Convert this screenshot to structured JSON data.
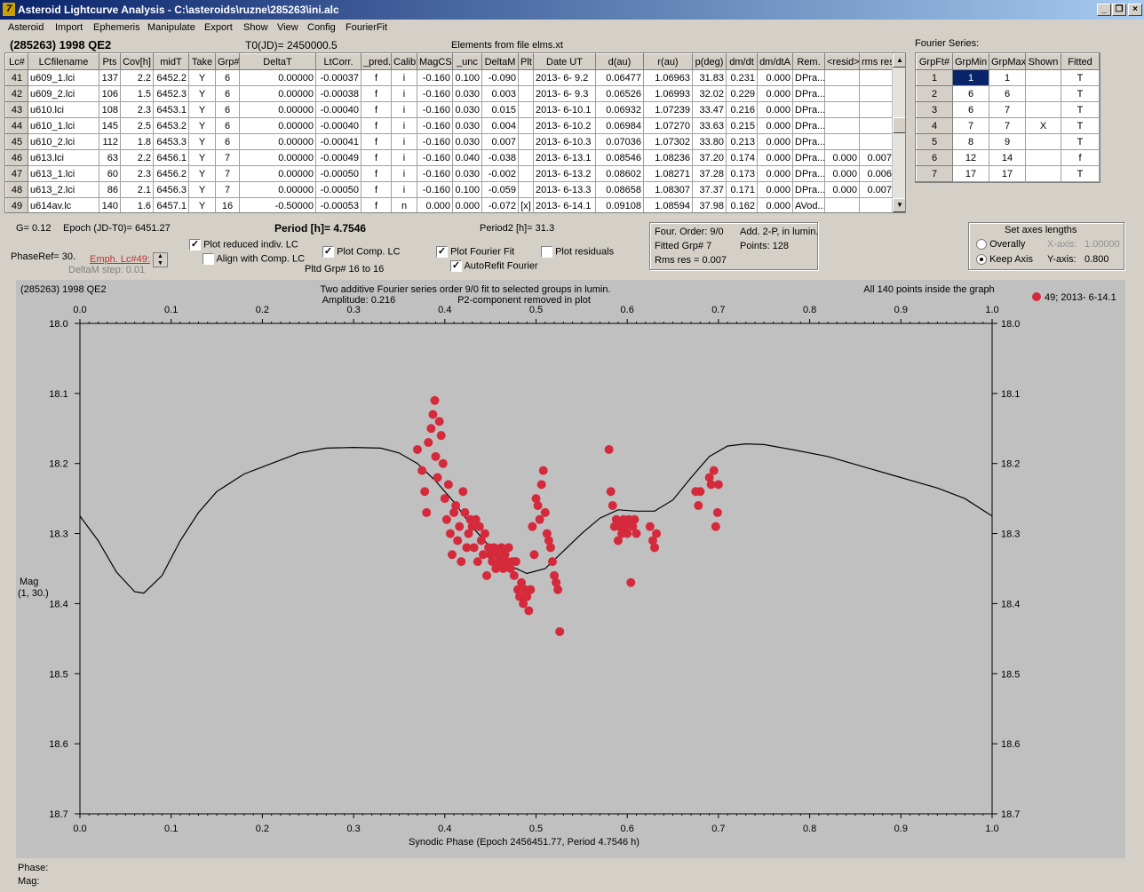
{
  "window": {
    "title": "Asteroid Lightcurve Analysis - C:\\asteroids\\ruzne\\285263\\ini.alc",
    "app_icon": "7"
  },
  "menu": [
    "Asteroid",
    "Import",
    "Ephemeris",
    "Manipulate",
    "Export",
    "Show",
    "View",
    "Config",
    "FourierFit"
  ],
  "header": {
    "asteroid": "(285263) 1998 QE2",
    "t0": "T0(JD)= 2450000.5",
    "elements": "Elements from file elms.xt",
    "fourier_title": "Fourier Series:"
  },
  "lc_table": {
    "columns": [
      "Lc#",
      "LCfilename",
      "Pts",
      "Cov[h]",
      "midT",
      "Take",
      "Grp#",
      "DeltaT",
      "LtCorr.",
      "_pred.",
      "Calib.",
      "MagCS",
      "_unc",
      "DeltaM",
      "Plt",
      "Date UT",
      "d(au)",
      "r(au)",
      "p(deg)",
      "dm/dt",
      "dm/dtA",
      "Rem.",
      "<resid>",
      "rms res"
    ],
    "rows": [
      [
        "41",
        "u609_1.lci",
        "137",
        "2.2",
        "6452.2",
        "Y",
        "6",
        "0.00000",
        "-0.00037",
        "f",
        "i",
        "-0.160",
        "0.100",
        "-0.090",
        "",
        "2013- 6- 9.2",
        "0.06477",
        "1.06963",
        "31.83",
        "0.231",
        "0.000",
        "DPra...",
        "",
        ""
      ],
      [
        "42",
        "u609_2.lci",
        "106",
        "1.5",
        "6452.3",
        "Y",
        "6",
        "0.00000",
        "-0.00038",
        "f",
        "i",
        "-0.160",
        "0.030",
        "0.003",
        "",
        "2013- 6- 9.3",
        "0.06526",
        "1.06993",
        "32.02",
        "0.229",
        "0.000",
        "DPra...",
        "",
        ""
      ],
      [
        "43",
        "u610.lci",
        "108",
        "2.3",
        "6453.1",
        "Y",
        "6",
        "0.00000",
        "-0.00040",
        "f",
        "i",
        "-0.160",
        "0.030",
        "0.015",
        "",
        "2013- 6-10.1",
        "0.06932",
        "1.07239",
        "33.47",
        "0.216",
        "0.000",
        "DPra...",
        "",
        ""
      ],
      [
        "44",
        "u610_1.lci",
        "145",
        "2.5",
        "6453.2",
        "Y",
        "6",
        "0.00000",
        "-0.00040",
        "f",
        "i",
        "-0.160",
        "0.030",
        "0.004",
        "",
        "2013- 6-10.2",
        "0.06984",
        "1.07270",
        "33.63",
        "0.215",
        "0.000",
        "DPra...",
        "",
        ""
      ],
      [
        "45",
        "u610_2.lci",
        "112",
        "1.8",
        "6453.3",
        "Y",
        "6",
        "0.00000",
        "-0.00041",
        "f",
        "i",
        "-0.160",
        "0.030",
        "0.007",
        "",
        "2013- 6-10.3",
        "0.07036",
        "1.07302",
        "33.80",
        "0.213",
        "0.000",
        "DPra...",
        "",
        ""
      ],
      [
        "46",
        "u613.lci",
        "63",
        "2.2",
        "6456.1",
        "Y",
        "7",
        "0.00000",
        "-0.00049",
        "f",
        "i",
        "-0.160",
        "0.040",
        "-0.038",
        "",
        "2013- 6-13.1",
        "0.08546",
        "1.08236",
        "37.20",
        "0.174",
        "0.000",
        "DPra...",
        "0.000",
        "0.007"
      ],
      [
        "47",
        "u613_1.lci",
        "60",
        "2.3",
        "6456.2",
        "Y",
        "7",
        "0.00000",
        "-0.00050",
        "f",
        "i",
        "-0.160",
        "0.030",
        "-0.002",
        "",
        "2013- 6-13.2",
        "0.08602",
        "1.08271",
        "37.28",
        "0.173",
        "0.000",
        "DPra...",
        "0.000",
        "0.006"
      ],
      [
        "48",
        "u613_2.lci",
        "86",
        "2.1",
        "6456.3",
        "Y",
        "7",
        "0.00000",
        "-0.00050",
        "f",
        "i",
        "-0.160",
        "0.100",
        "-0.059",
        "",
        "2013- 6-13.3",
        "0.08658",
        "1.08307",
        "37.37",
        "0.171",
        "0.000",
        "DPra...",
        "0.000",
        "0.007"
      ],
      [
        "49",
        "u614av.lc",
        "140",
        "1.6",
        "6457.1",
        "Y",
        "16",
        "-0.50000",
        "-0.00053",
        "f",
        "n",
        "0.000",
        "0.000",
        "-0.072",
        "[x]",
        "2013- 6-14.1",
        "0.09108",
        "1.08594",
        "37.98",
        "0.162",
        "0.000",
        "AVod...",
        "",
        ""
      ]
    ]
  },
  "fourier_table": {
    "columns": [
      "GrpFt#",
      "GrpMin",
      "GrpMax",
      "Shown",
      "Fitted"
    ],
    "rows": [
      [
        "1",
        "1",
        "1",
        "",
        "T"
      ],
      [
        "2",
        "6",
        "6",
        "",
        "T"
      ],
      [
        "3",
        "6",
        "7",
        "",
        "T"
      ],
      [
        "4",
        "7",
        "7",
        "X",
        "T"
      ],
      [
        "5",
        "8",
        "9",
        "",
        "T"
      ],
      [
        "6",
        "12",
        "14",
        "",
        "f"
      ],
      [
        "7",
        "17",
        "17",
        "",
        "T"
      ]
    ]
  },
  "params": {
    "g": "G= 0.12",
    "epoch": "Epoch (JD-T0)= 6451.27",
    "period": "Period [h]= 4.7546",
    "period2": "Period2 [h]= 31.3",
    "phaseref": "PhaseRef= 30.",
    "emph": "Emph. Lc#49:",
    "deltam_step": "DeltaM step: 0.01",
    "plot_reduced": "Plot reduced indiv. LC",
    "align": "Align with Comp. LC",
    "plot_comp": "Plot Comp. LC",
    "pltd_grp": "Pltd Grp#  16 to   16",
    "plot_fourier": "Plot Fourier Fit",
    "autorefit": "AutoRefit Fourier",
    "plot_resid": "Plot residuals",
    "four_order": "Four. Order:  9/0",
    "add2p": "Add. 2-P, in lumin.",
    "fitted_grp": "Fitted Grp# 7",
    "points": "Points: 128",
    "rms": "Rms res     = 0.007",
    "axes_title": "Set axes lengths",
    "overally": "Overally",
    "keep_axis": "Keep Axis",
    "xaxis_label": "X-axis:",
    "xaxis_val": "1.00000",
    "yaxis_label": "Y-axis:",
    "yaxis_val": "0.800"
  },
  "checks": {
    "plot_reduced": true,
    "align": false,
    "plot_comp": true,
    "plot_fourier": true,
    "autorefit": true,
    "plot_resid": false,
    "keep_axis": true
  },
  "chart_data": {
    "type": "scatter",
    "title": "Two additive Fourier series order 9/0 fit to selected groups in lumin.",
    "subtitle": "Amplitude: 0.216",
    "note": "P2-component removed in plot",
    "corner_label": "(285263) 1998 QE2",
    "status": "All 140 points inside the graph",
    "legend": "49; 2013- 6-14.1",
    "xlabel": "Synodic Phase (Epoch 2456451.77, Period 4.7546 h)",
    "ylabel": "Mag",
    "ylabel2": "(1, 30.)",
    "xlim": [
      0.0,
      1.0
    ],
    "ylim": [
      18.7,
      18.0
    ],
    "xticks": [
      "0.0",
      "0.1",
      "0.2",
      "0.3",
      "0.4",
      "0.5",
      "0.6",
      "0.7",
      "0.8",
      "0.9",
      "1.0"
    ],
    "yticks": [
      "18.0",
      "18.1",
      "18.2",
      "18.3",
      "18.4",
      "18.5",
      "18.6",
      "18.7"
    ],
    "point_color": "#d42a3c",
    "fit_curve": [
      [
        0.0,
        18.275
      ],
      [
        0.02,
        18.31
      ],
      [
        0.04,
        18.355
      ],
      [
        0.06,
        18.383
      ],
      [
        0.07,
        18.385
      ],
      [
        0.09,
        18.36
      ],
      [
        0.11,
        18.31
      ],
      [
        0.13,
        18.27
      ],
      [
        0.15,
        18.24
      ],
      [
        0.18,
        18.215
      ],
      [
        0.21,
        18.2
      ],
      [
        0.24,
        18.185
      ],
      [
        0.27,
        18.178
      ],
      [
        0.3,
        18.177
      ],
      [
        0.33,
        18.178
      ],
      [
        0.35,
        18.185
      ],
      [
        0.37,
        18.2
      ],
      [
        0.39,
        18.225
      ],
      [
        0.41,
        18.255
      ],
      [
        0.43,
        18.29
      ],
      [
        0.45,
        18.32
      ],
      [
        0.47,
        18.345
      ],
      [
        0.49,
        18.357
      ],
      [
        0.51,
        18.35
      ],
      [
        0.53,
        18.325
      ],
      [
        0.55,
        18.3
      ],
      [
        0.57,
        18.278
      ],
      [
        0.59,
        18.266
      ],
      [
        0.61,
        18.268
      ],
      [
        0.63,
        18.268
      ],
      [
        0.65,
        18.252
      ],
      [
        0.67,
        18.22
      ],
      [
        0.69,
        18.19
      ],
      [
        0.71,
        18.175
      ],
      [
        0.73,
        18.172
      ],
      [
        0.75,
        18.173
      ],
      [
        0.78,
        18.18
      ],
      [
        0.82,
        18.19
      ],
      [
        0.86,
        18.205
      ],
      [
        0.9,
        18.22
      ],
      [
        0.94,
        18.235
      ],
      [
        0.97,
        18.25
      ],
      [
        1.0,
        18.275
      ]
    ],
    "points": [
      [
        0.37,
        18.18
      ],
      [
        0.375,
        18.21
      ],
      [
        0.378,
        18.24
      ],
      [
        0.38,
        18.27
      ],
      [
        0.382,
        18.17
      ],
      [
        0.385,
        18.15
      ],
      [
        0.387,
        18.13
      ],
      [
        0.389,
        18.11
      ],
      [
        0.39,
        18.19
      ],
      [
        0.392,
        18.22
      ],
      [
        0.394,
        18.14
      ],
      [
        0.396,
        18.16
      ],
      [
        0.398,
        18.2
      ],
      [
        0.4,
        18.25
      ],
      [
        0.402,
        18.28
      ],
      [
        0.404,
        18.23
      ],
      [
        0.406,
        18.3
      ],
      [
        0.408,
        18.33
      ],
      [
        0.41,
        18.27
      ],
      [
        0.412,
        18.26
      ],
      [
        0.414,
        18.31
      ],
      [
        0.416,
        18.29
      ],
      [
        0.418,
        18.34
      ],
      [
        0.42,
        18.24
      ],
      [
        0.422,
        18.27
      ],
      [
        0.424,
        18.32
      ],
      [
        0.426,
        18.3
      ],
      [
        0.428,
        18.28
      ],
      [
        0.43,
        18.29
      ],
      [
        0.432,
        18.32
      ],
      [
        0.434,
        18.28
      ],
      [
        0.436,
        18.34
      ],
      [
        0.438,
        18.29
      ],
      [
        0.44,
        18.31
      ],
      [
        0.442,
        18.33
      ],
      [
        0.444,
        18.3
      ],
      [
        0.446,
        18.36
      ],
      [
        0.448,
        18.32
      ],
      [
        0.45,
        18.33
      ],
      [
        0.452,
        18.34
      ],
      [
        0.454,
        18.32
      ],
      [
        0.456,
        18.35
      ],
      [
        0.458,
        18.33
      ],
      [
        0.46,
        18.34
      ],
      [
        0.462,
        18.32
      ],
      [
        0.464,
        18.35
      ],
      [
        0.466,
        18.33
      ],
      [
        0.468,
        18.34
      ],
      [
        0.47,
        18.32
      ],
      [
        0.472,
        18.35
      ],
      [
        0.474,
        18.34
      ],
      [
        0.476,
        18.36
      ],
      [
        0.478,
        18.34
      ],
      [
        0.48,
        18.38
      ],
      [
        0.482,
        18.39
      ],
      [
        0.484,
        18.37
      ],
      [
        0.486,
        18.4
      ],
      [
        0.488,
        18.38
      ],
      [
        0.49,
        18.39
      ],
      [
        0.492,
        18.41
      ],
      [
        0.494,
        18.38
      ],
      [
        0.496,
        18.29
      ],
      [
        0.498,
        18.33
      ],
      [
        0.5,
        18.25
      ],
      [
        0.502,
        18.26
      ],
      [
        0.504,
        18.28
      ],
      [
        0.506,
        18.23
      ],
      [
        0.508,
        18.21
      ],
      [
        0.51,
        18.27
      ],
      [
        0.512,
        18.3
      ],
      [
        0.514,
        18.31
      ],
      [
        0.516,
        18.32
      ],
      [
        0.518,
        18.34
      ],
      [
        0.52,
        18.36
      ],
      [
        0.522,
        18.37
      ],
      [
        0.524,
        18.38
      ],
      [
        0.526,
        18.44
      ],
      [
        0.58,
        18.18
      ],
      [
        0.582,
        18.24
      ],
      [
        0.584,
        18.26
      ],
      [
        0.586,
        18.29
      ],
      [
        0.588,
        18.28
      ],
      [
        0.59,
        18.31
      ],
      [
        0.592,
        18.29
      ],
      [
        0.594,
        18.3
      ],
      [
        0.596,
        18.28
      ],
      [
        0.598,
        18.29
      ],
      [
        0.6,
        18.3
      ],
      [
        0.602,
        18.28
      ],
      [
        0.604,
        18.37
      ],
      [
        0.606,
        18.29
      ],
      [
        0.608,
        18.28
      ],
      [
        0.61,
        18.3
      ],
      [
        0.625,
        18.29
      ],
      [
        0.628,
        18.31
      ],
      [
        0.63,
        18.32
      ],
      [
        0.632,
        18.3
      ],
      [
        0.675,
        18.24
      ],
      [
        0.678,
        18.26
      ],
      [
        0.68,
        18.24
      ],
      [
        0.69,
        18.22
      ],
      [
        0.692,
        18.23
      ],
      [
        0.695,
        18.21
      ],
      [
        0.697,
        18.29
      ],
      [
        0.699,
        18.27
      ],
      [
        0.7,
        18.23
      ]
    ]
  },
  "footer": {
    "phase": "Phase:",
    "mag": "Mag:"
  }
}
